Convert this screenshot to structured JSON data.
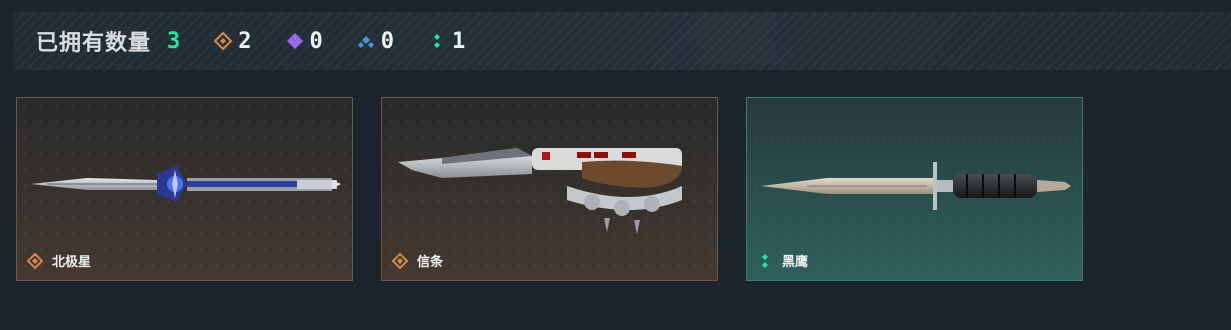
{
  "header": {
    "title": "已拥有数量",
    "total": "3",
    "rarities": [
      {
        "icon": "orange-diamond-icon",
        "color": "#d8874a",
        "count": "2"
      },
      {
        "icon": "purple-diamond-icon",
        "color": "#9a6cf0",
        "count": "0"
      },
      {
        "icon": "blue-diamond-icon",
        "color": "#4f8fe0",
        "count": "0"
      },
      {
        "icon": "green-diamond-icon",
        "color": "#2ee0a0",
        "count": "1"
      }
    ]
  },
  "cards": [
    {
      "name": "北极星",
      "rarity_color": "#d8874a",
      "icon": "orange-diamond-icon",
      "image": "polaris-knife"
    },
    {
      "name": "信条",
      "rarity_color": "#d8874a",
      "icon": "orange-diamond-icon",
      "image": "knuckle-knife"
    },
    {
      "name": "黑鹰",
      "rarity_color": "#2ee0a0",
      "icon": "green-diamond-icon",
      "image": "bayonet-knife"
    }
  ]
}
